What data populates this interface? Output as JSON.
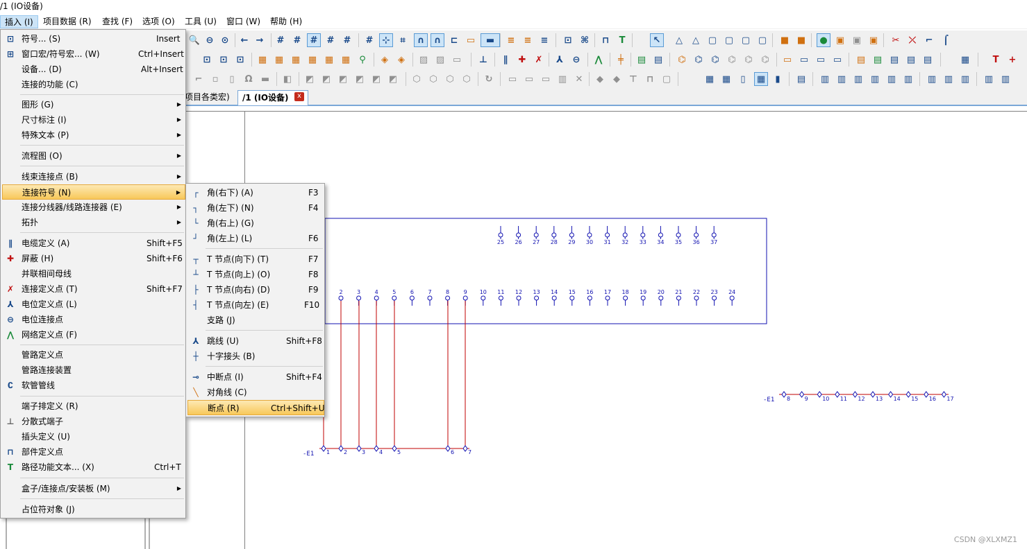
{
  "window_title": "/1 (IO设备)",
  "menubar": [
    {
      "label": "插入 (I)",
      "active": true
    },
    {
      "label": "项目数据 (R)"
    },
    {
      "label": "查找 (F)"
    },
    {
      "label": "选项 (O)"
    },
    {
      "label": "工具 (U)"
    },
    {
      "label": "窗口 (W)"
    },
    {
      "label": "帮助 (H)"
    }
  ],
  "tabs": {
    "inactive_label": "项目各类宏)",
    "active_label": "/1 (IO设备)",
    "close_glyph": "x"
  },
  "insert_menu": [
    {
      "label": "符号... (S)",
      "shortcut": "Insert",
      "icon": "symbol-icon"
    },
    {
      "label": "窗口宏/符号宏... (W)",
      "shortcut": "Ctrl+Insert",
      "icon": "macro-icon"
    },
    {
      "label": "设备... (D)",
      "shortcut": "Alt+Insert"
    },
    {
      "label": "连接的功能 (C)"
    },
    {
      "label": "图形 (G)",
      "submenu": true
    },
    {
      "label": "尺寸标注 (I)",
      "submenu": true
    },
    {
      "label": "特殊文本 (P)",
      "submenu": true
    },
    {
      "label": "流程图 (O)",
      "submenu": true
    },
    {
      "label": "线束连接点 (B)",
      "submenu": true
    },
    {
      "label": "连接符号 (N)",
      "submenu": true,
      "highlighted": true
    },
    {
      "label": "连接分线器/线路连接器 (E)",
      "submenu": true
    },
    {
      "label": "拓扑",
      "submenu": true
    },
    {
      "label": "电缆定义 (A)",
      "shortcut": "Shift+F5",
      "icon": "cable-icon"
    },
    {
      "label": "屏蔽 (H)",
      "shortcut": "Shift+F6",
      "icon": "shield-icon"
    },
    {
      "label": "并联相间母线"
    },
    {
      "label": "连接定义点 (T)",
      "shortcut": "Shift+F7",
      "icon": "connection-definition-icon"
    },
    {
      "label": "电位定义点 (L)",
      "icon": "potential-definition-icon"
    },
    {
      "label": "电位连接点",
      "icon": "potential-connection-icon"
    },
    {
      "label": "网络定义点 (F)",
      "icon": "network-definition-icon"
    },
    {
      "label": "管路定义点"
    },
    {
      "label": "管路连接装置"
    },
    {
      "label": "软管管线",
      "icon": "hose-icon"
    },
    {
      "label": "端子排定义 (R)"
    },
    {
      "label": "分散式端子",
      "icon": "distributed-terminal-icon"
    },
    {
      "label": "插头定义 (U)"
    },
    {
      "label": "部件定义点",
      "icon": "cart-icon"
    },
    {
      "label": "路径功能文本... (X)",
      "shortcut": "Ctrl+T",
      "icon": "path-text-icon"
    },
    {
      "label": "盒子/连接点/安装板 (M)",
      "submenu": true
    },
    {
      "label": "占位符对象 (J)"
    }
  ],
  "connection_submenu": [
    {
      "label": "角(右下) (A)",
      "shortcut": "F3"
    },
    {
      "label": "角(左下) (N)",
      "shortcut": "F4"
    },
    {
      "label": "角(右上) (G)"
    },
    {
      "label": "角(左上) (L)",
      "shortcut": "F6"
    },
    {
      "label": "T 节点(向下) (T)",
      "shortcut": "F7"
    },
    {
      "label": "T 节点(向上) (O)",
      "shortcut": "F8"
    },
    {
      "label": "T 节点(向右) (D)",
      "shortcut": "F9"
    },
    {
      "label": "T 节点(向左) (E)",
      "shortcut": "F10"
    },
    {
      "label": "支路 (J)"
    },
    {
      "label": "跳线 (U)",
      "shortcut": "Shift+F8"
    },
    {
      "label": "十字接头 (B)"
    },
    {
      "label": "中断点 (I)",
      "shortcut": "Shift+F4"
    },
    {
      "label": "对角线 (C)"
    },
    {
      "label": "断点 (R)",
      "shortcut": "Ctrl+Shift+U",
      "highlighted": true
    }
  ],
  "schematic": {
    "device_top_pins": [
      "25",
      "26",
      "27",
      "28",
      "29",
      "30",
      "31",
      "32",
      "33",
      "34",
      "35",
      "36",
      "37"
    ],
    "device_bottom_pins": [
      "2",
      "3",
      "4",
      "5",
      "6",
      "7",
      "8",
      "9",
      "10",
      "11",
      "12",
      "13",
      "14",
      "15",
      "16",
      "17",
      "18",
      "19",
      "20",
      "21",
      "22",
      "23",
      "24"
    ],
    "terminal_strip_left_label": "-E1",
    "terminal_strip_left": [
      "1",
      "2",
      "3",
      "4",
      "5",
      "6",
      "7"
    ],
    "terminal_strip_right_label": "-E1",
    "terminal_strip_right": [
      "8",
      "9",
      "10",
      "11",
      "12",
      "13",
      "14",
      "15",
      "16",
      "17"
    ]
  },
  "colors": {
    "wire": "#c00000",
    "device": "#1010b0",
    "menu_highlight": "#f8c85a"
  },
  "watermark": "CSDN @XLXMZ1"
}
